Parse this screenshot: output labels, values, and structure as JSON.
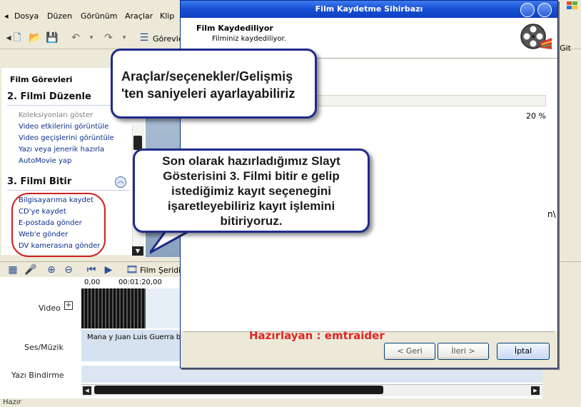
{
  "menu": [
    "Dosya",
    "Düzen",
    "Görünüm",
    "Araçlar",
    "Klip"
  ],
  "toolbar": {
    "gorev_label": "Görevle"
  },
  "goto_text": "Git",
  "taskpane": {
    "header": "Film Görevleri",
    "section2": "2. Filmi Düzenle",
    "section2_items": [
      "Koleksiyonları göster",
      "Video etkilerini görüntüle",
      "Video geçişlerini görüntüle",
      "Yazı veya jenerik hazırla",
      "AutoMovie yap"
    ],
    "section3": "3. Filmi Bitir",
    "section3_items": [
      "Bilgisayarıma kaydet",
      "CD'ye kaydet",
      "E-postada gönder",
      "Web'e gönder",
      "DV kamerasına gönder"
    ]
  },
  "timeline": {
    "storyboard_label": "Film Şeridi'",
    "ruler": [
      "0,00",
      "00:01:20,00"
    ],
    "track_video": "Video",
    "track_audio": "Ses/Müzik",
    "track_overlay": "Yazı Bindirme",
    "audio_clip": "Mana y Juan Luis Guerra be"
  },
  "status_text": "Hazır",
  "wizard": {
    "title": "Film Kaydetme Sihirbazı",
    "head_title": "Film Kaydediliyor",
    "head_sub": "Filminiz kaydediliyor.",
    "progress_percent_label": "20 %",
    "progress": 0.2,
    "partial_path": "n\\",
    "buttons": {
      "back": "< Geri",
      "next": "İleri >",
      "cancel": "İptal"
    },
    "author": "Hazırlayan : emtraider"
  },
  "callouts": {
    "top": "Araçlar/seçenekler/Gelişmiş 'ten saniyeleri ayarlayabiliriz",
    "bottom": "Son olarak hazırladığımız Slayt Gösterisini 3. Filmi bitir e gelip istediğimiz kayıt seçenegini işaretleyebiliriz kayıt işlemini bitiriyoruz."
  },
  "colors": {
    "title_blue": "#1a52d6",
    "accent_red": "#e02525",
    "callout_border": "#1f2b8a"
  }
}
